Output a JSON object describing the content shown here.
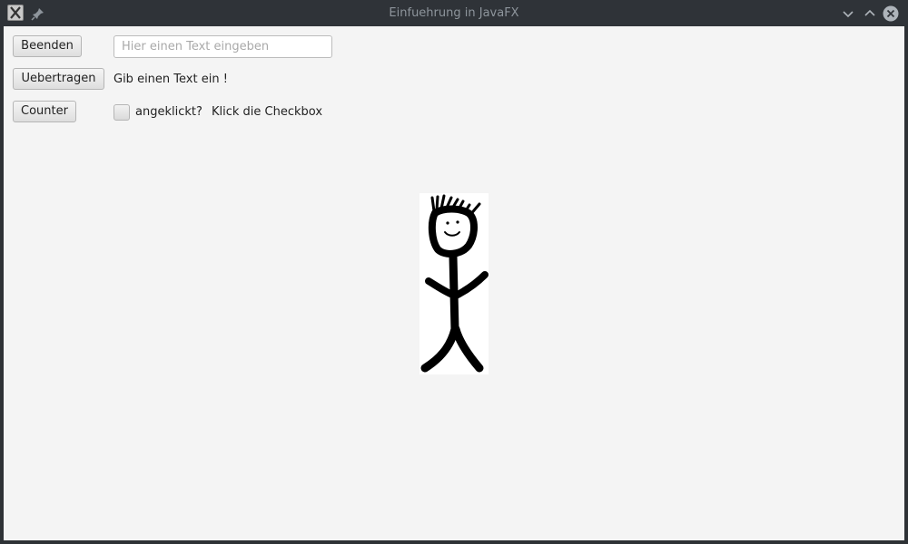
{
  "window": {
    "title": "Einfuehrung in JavaFX"
  },
  "icons": {
    "app": "x11-app-icon",
    "pin": "pin-icon",
    "minimize": "chevron-down-icon",
    "maximize": "chevron-up-icon",
    "close": "close-icon"
  },
  "controls": {
    "quit_button": "Beenden",
    "transfer_button": "Uebertragen",
    "counter_button": "Counter",
    "text_field": {
      "value": "",
      "placeholder": "Hier einen Text eingeben"
    },
    "output_label": "Gib einen Text ein !",
    "checkbox": {
      "label": "angeklickt?",
      "checked": false
    },
    "checkbox_status": "Klick die Checkbox"
  },
  "image": {
    "subject": "stick-figure"
  },
  "colors": {
    "titlebar": "#2f3338",
    "client_bg": "#f4f4f4",
    "title_text": "#8e959c"
  }
}
